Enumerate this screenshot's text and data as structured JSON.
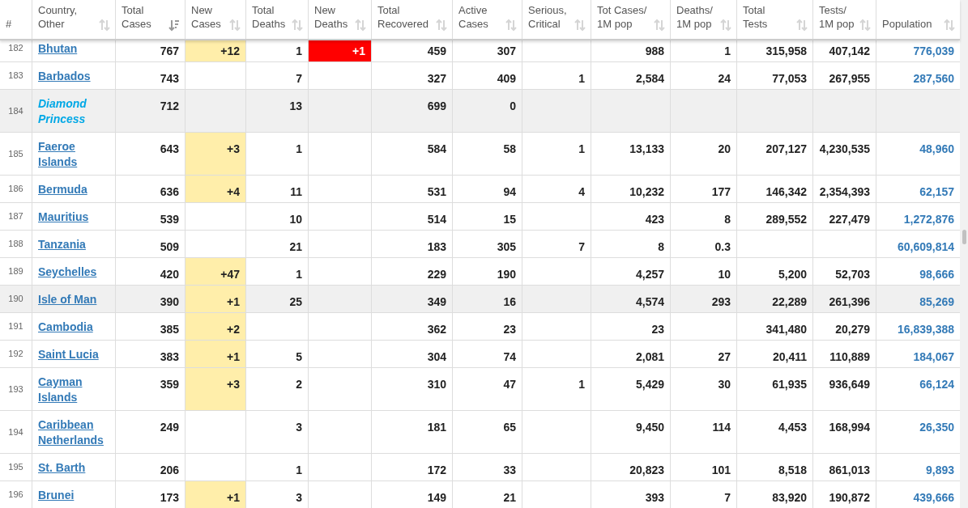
{
  "columns": [
    {
      "label": "#",
      "sortable": false
    },
    {
      "label": "Country,\nOther",
      "sortable": true,
      "sorted": false
    },
    {
      "label": "Total\nCases",
      "sortable": true,
      "sorted": true
    },
    {
      "label": "New\nCases",
      "sortable": true,
      "sorted": false
    },
    {
      "label": "Total\nDeaths",
      "sortable": true,
      "sorted": false
    },
    {
      "label": "New\nDeaths",
      "sortable": true,
      "sorted": false
    },
    {
      "label": "Total\nRecovered",
      "sortable": true,
      "sorted": false
    },
    {
      "label": "Active\nCases",
      "sortable": true,
      "sorted": false
    },
    {
      "label": "Serious,\nCritical",
      "sortable": true,
      "sorted": false
    },
    {
      "label": "Tot Cases/\n1M pop",
      "sortable": true,
      "sorted": false
    },
    {
      "label": "Deaths/\n1M pop",
      "sortable": true,
      "sorted": false
    },
    {
      "label": "Total\nTests",
      "sortable": true,
      "sorted": false
    },
    {
      "label": "Tests/\n1M pop",
      "sortable": true,
      "sorted": false
    },
    {
      "label": "Population",
      "sortable": true,
      "sorted": false
    }
  ],
  "rows": [
    {
      "num": "182",
      "country": "Bhutan",
      "kind": "country",
      "highlighted": false,
      "total_cases": "767",
      "new_cases": "+12",
      "total_deaths": "1",
      "new_deaths": "+1",
      "total_recovered": "459",
      "active_cases": "307",
      "tot_cases_1m": "988",
      "deaths_1m": "1",
      "total_tests": "315,958",
      "tests_1m": "407,142",
      "population": "776,039"
    },
    {
      "num": "183",
      "country": "Barbados",
      "kind": "country",
      "highlighted": false,
      "total_cases": "743",
      "total_deaths": "7",
      "total_recovered": "327",
      "active_cases": "409",
      "serious_critical": "1",
      "tot_cases_1m": "2,584",
      "deaths_1m": "24",
      "total_tests": "77,053",
      "tests_1m": "267,955",
      "population": "287,560"
    },
    {
      "num": "184",
      "country": "Diamond Princess",
      "kind": "ship",
      "highlighted": true,
      "total_cases": "712",
      "total_deaths": "13",
      "total_recovered": "699",
      "active_cases": "0"
    },
    {
      "num": "185",
      "country": "Faeroe Islands",
      "kind": "country",
      "highlighted": false,
      "total_cases": "643",
      "new_cases": "+3",
      "total_deaths": "1",
      "total_recovered": "584",
      "active_cases": "58",
      "serious_critical": "1",
      "tot_cases_1m": "13,133",
      "deaths_1m": "20",
      "total_tests": "207,127",
      "tests_1m": "4,230,535",
      "population": "48,960"
    },
    {
      "num": "186",
      "country": "Bermuda",
      "kind": "country",
      "highlighted": false,
      "total_cases": "636",
      "new_cases": "+4",
      "total_deaths": "11",
      "total_recovered": "531",
      "active_cases": "94",
      "serious_critical": "4",
      "tot_cases_1m": "10,232",
      "deaths_1m": "177",
      "total_tests": "146,342",
      "tests_1m": "2,354,393",
      "population": "62,157"
    },
    {
      "num": "187",
      "country": "Mauritius",
      "kind": "country",
      "highlighted": false,
      "total_cases": "539",
      "total_deaths": "10",
      "total_recovered": "514",
      "active_cases": "15",
      "tot_cases_1m": "423",
      "deaths_1m": "8",
      "total_tests": "289,552",
      "tests_1m": "227,479",
      "population": "1,272,876"
    },
    {
      "num": "188",
      "country": "Tanzania",
      "kind": "country",
      "highlighted": false,
      "total_cases": "509",
      "total_deaths": "21",
      "total_recovered": "183",
      "active_cases": "305",
      "serious_critical": "7",
      "tot_cases_1m": "8",
      "deaths_1m": "0.3",
      "population": "60,609,814"
    },
    {
      "num": "189",
      "country": "Seychelles",
      "kind": "country",
      "highlighted": false,
      "total_cases": "420",
      "new_cases": "+47",
      "total_deaths": "1",
      "total_recovered": "229",
      "active_cases": "190",
      "tot_cases_1m": "4,257",
      "deaths_1m": "10",
      "total_tests": "5,200",
      "tests_1m": "52,703",
      "population": "98,666"
    },
    {
      "num": "190",
      "country": "Isle of Man",
      "kind": "country",
      "highlighted": true,
      "total_cases": "390",
      "new_cases": "+1",
      "total_deaths": "25",
      "total_recovered": "349",
      "active_cases": "16",
      "tot_cases_1m": "4,574",
      "deaths_1m": "293",
      "total_tests": "22,289",
      "tests_1m": "261,396",
      "population": "85,269"
    },
    {
      "num": "191",
      "country": "Cambodia",
      "kind": "country",
      "highlighted": false,
      "total_cases": "385",
      "new_cases": "+2",
      "total_recovered": "362",
      "active_cases": "23",
      "tot_cases_1m": "23",
      "total_tests": "341,480",
      "tests_1m": "20,279",
      "population": "16,839,388"
    },
    {
      "num": "192",
      "country": "Saint Lucia",
      "kind": "country",
      "highlighted": false,
      "total_cases": "383",
      "new_cases": "+1",
      "total_deaths": "5",
      "total_recovered": "304",
      "active_cases": "74",
      "tot_cases_1m": "2,081",
      "deaths_1m": "27",
      "total_tests": "20,411",
      "tests_1m": "110,889",
      "population": "184,067"
    },
    {
      "num": "193",
      "country": "Cayman Islands",
      "kind": "country",
      "highlighted": false,
      "total_cases": "359",
      "new_cases": "+3",
      "total_deaths": "2",
      "total_recovered": "310",
      "active_cases": "47",
      "serious_critical": "1",
      "tot_cases_1m": "5,429",
      "deaths_1m": "30",
      "total_tests": "61,935",
      "tests_1m": "936,649",
      "population": "66,124"
    },
    {
      "num": "194",
      "country": "Caribbean Netherlands",
      "kind": "country",
      "highlighted": false,
      "total_cases": "249",
      "total_deaths": "3",
      "total_recovered": "181",
      "active_cases": "65",
      "tot_cases_1m": "9,450",
      "deaths_1m": "114",
      "total_tests": "4,453",
      "tests_1m": "168,994",
      "population": "26,350"
    },
    {
      "num": "195",
      "country": "St. Barth",
      "kind": "country",
      "highlighted": false,
      "total_cases": "206",
      "total_deaths": "1",
      "total_recovered": "172",
      "active_cases": "33",
      "tot_cases_1m": "20,823",
      "deaths_1m": "101",
      "total_tests": "8,518",
      "tests_1m": "861,013",
      "population": "9,893"
    },
    {
      "num": "196",
      "country": "Brunei",
      "kind": "country",
      "highlighted": false,
      "total_cases": "173",
      "new_cases": "+1",
      "total_deaths": "3",
      "total_recovered": "149",
      "active_cases": "21",
      "tot_cases_1m": "393",
      "deaths_1m": "7",
      "total_tests": "83,920",
      "tests_1m": "190,872",
      "population": "439,666"
    }
  ]
}
